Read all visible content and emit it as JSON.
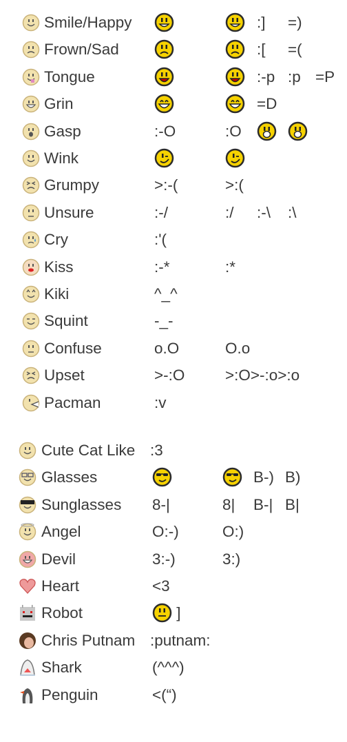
{
  "colors": {
    "text": "#3a3a3a",
    "emoji_yellow": "#f6d200",
    "emoji_outline": "#2b2b2b",
    "icon_beige": "#f2e2ae"
  },
  "tables": [
    {
      "rows": [
        {
          "icon": "smile-icon",
          "name": "Smile/Happy",
          "cells": [
            {
              "emoji": "smile"
            },
            {
              "emoji": "smile"
            },
            {
              "text": ":]"
            },
            {
              "text": "=)"
            }
          ]
        },
        {
          "icon": "frown-icon",
          "name": "Frown/Sad",
          "cells": [
            {
              "emoji": "frown"
            },
            {
              "emoji": "frown"
            },
            {
              "text": ":["
            },
            {
              "text": "=("
            }
          ]
        },
        {
          "icon": "tongue-icon",
          "name": "Tongue",
          "cells": [
            {
              "emoji": "tongue"
            },
            {
              "emoji": "tongue"
            },
            {
              "text": ":-p"
            },
            {
              "text": ":p"
            },
            {
              "text": "=P"
            }
          ]
        },
        {
          "icon": "grin-icon",
          "name": "Grin",
          "cells": [
            {
              "emoji": "grin"
            },
            {
              "emoji": "grin"
            },
            {
              "text": "=D"
            }
          ]
        },
        {
          "icon": "gasp-icon",
          "name": "Gasp",
          "cells": [
            {
              "text": ":-O"
            },
            {
              "text": ":O"
            },
            {
              "emoji": "gasp"
            },
            {
              "emoji": "gasp"
            }
          ]
        },
        {
          "icon": "wink-icon",
          "name": "Wink",
          "cells": [
            {
              "emoji": "wink"
            },
            {
              "emoji": "wink"
            }
          ]
        },
        {
          "icon": "grumpy-icon",
          "name": "Grumpy",
          "cells": [
            {
              "text": ">:-("
            },
            {
              "text": ">:("
            }
          ]
        },
        {
          "icon": "unsure-icon",
          "name": "Unsure",
          "cells": [
            {
              "text": ":-/"
            },
            {
              "text": ":/"
            },
            {
              "text": ":-\\"
            },
            {
              "text": ":\\"
            }
          ]
        },
        {
          "icon": "cry-icon",
          "name": "Cry",
          "cells": [
            {
              "text": ":'("
            }
          ]
        },
        {
          "icon": "kiss-icon",
          "name": "Kiss",
          "cells": [
            {
              "text": ":-*"
            },
            {
              "text": ":*"
            }
          ]
        },
        {
          "icon": "kiki-icon",
          "name": "Kiki",
          "cells": [
            {
              "text": "^_^"
            }
          ]
        },
        {
          "icon": "squint-icon",
          "name": "Squint",
          "cells": [
            {
              "text": "-_-"
            }
          ]
        },
        {
          "icon": "confuse-icon",
          "name": "Confuse",
          "cells": [
            {
              "text": "o.O"
            },
            {
              "text": "O.o"
            }
          ]
        },
        {
          "icon": "upset-icon",
          "name": "Upset",
          "cells": [
            {
              "text": ">-:O"
            },
            {
              "text": ">:O>-:o>:o"
            }
          ]
        },
        {
          "icon": "pacman-icon",
          "name": "Pacman",
          "cells": [
            {
              "text": ":v"
            }
          ]
        }
      ]
    },
    {
      "rows": [
        {
          "icon": "cat-icon",
          "name": "Cute Cat Like",
          "cells": [
            {
              "text": ":3"
            }
          ]
        },
        {
          "icon": "glasses-icon",
          "name": "Glasses",
          "cells": [
            {
              "emoji": "cool"
            },
            {
              "emoji": "cool"
            },
            {
              "text": "B-)"
            },
            {
              "text": "B)"
            }
          ]
        },
        {
          "icon": "sunglasses-icon",
          "name": "Sunglasses",
          "cells": [
            {
              "text": "8-|"
            },
            {
              "text": "8|"
            },
            {
              "text": "B-|"
            },
            {
              "text": "B|"
            }
          ]
        },
        {
          "icon": "angel-icon",
          "name": "Angel",
          "cells": [
            {
              "text": "O:-)"
            },
            {
              "text": "O:)"
            }
          ]
        },
        {
          "icon": "devil-icon",
          "name": "Devil",
          "cells": [
            {
              "text": "3:-)"
            },
            {
              "text": "3:)"
            }
          ]
        },
        {
          "icon": "heart-icon",
          "name": "Heart",
          "cells": [
            {
              "text": "<3"
            }
          ]
        },
        {
          "icon": "robot-icon",
          "name": "Robot",
          "cells": [
            {
              "emoji": "neutral",
              "text": " ]"
            }
          ]
        },
        {
          "icon": "chris-putnam-avatar-icon",
          "name": "Chris Putnam",
          "cells": [
            {
              "text": ":putnam:"
            }
          ]
        },
        {
          "icon": "shark-icon",
          "name": "Shark",
          "cells": [
            {
              "text": "(^^^)"
            }
          ]
        },
        {
          "icon": "penguin-icon",
          "name": "Penguin",
          "cells": [
            {
              "text": "<(“)"
            }
          ]
        }
      ]
    }
  ]
}
